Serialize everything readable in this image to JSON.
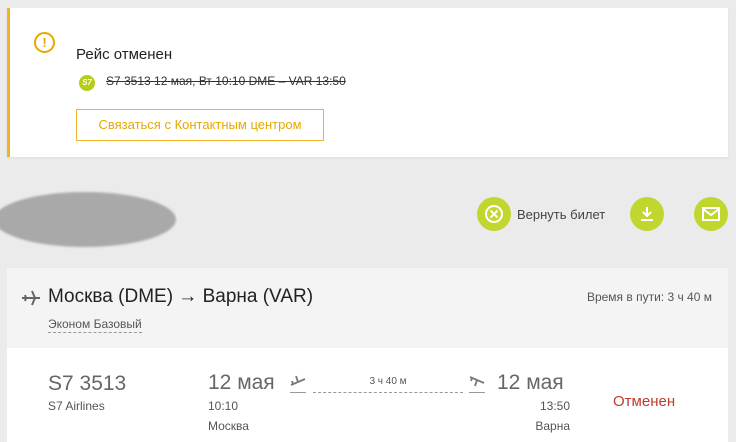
{
  "alert": {
    "title": "Рейс отменен",
    "badge": "S7",
    "flight_line": "S7 3513   12 мая, Вт   10:10 DME – VAR 13:50",
    "contact_button": "Связаться с Контактным центром"
  },
  "actions": {
    "refund_label": "Вернуть билет"
  },
  "route": {
    "title": "Москва (DME) → Варна (VAR)",
    "fare_class": "Эконом Базовый",
    "total_duration": "Время в пути: 3 ч 40 м"
  },
  "segment": {
    "flight_number": "S7 3513",
    "airline": "S7 Airlines",
    "departure": {
      "date": "12 мая",
      "time": "10:10",
      "city": "Москва"
    },
    "arrival": {
      "date": "12 мая",
      "time": "13:50",
      "city": "Варна"
    },
    "duration": "3 ч 40 м",
    "status": "Отменен"
  },
  "colors": {
    "accent_green": "#c1d72f",
    "warning_yellow": "#f0b323",
    "status_red": "#c0392b"
  },
  "icons": [
    "warning-icon",
    "s7-logo-icon",
    "cancel-circle-icon",
    "download-icon",
    "mail-icon",
    "plane-icon",
    "takeoff-icon",
    "landing-icon"
  ]
}
